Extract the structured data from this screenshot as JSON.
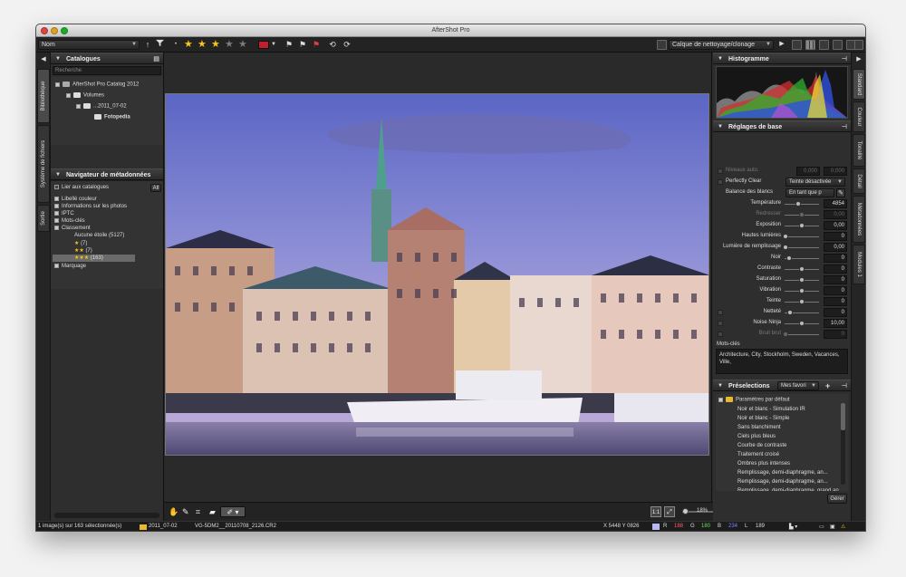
{
  "window": {
    "title": "AfterShot Pro"
  },
  "toolbar": {
    "sort_select": "Nom",
    "rating": 3,
    "rating_max": 5,
    "label_color": "#c0202a",
    "layer_select": "Calque de nettoyage/clonage"
  },
  "left_tabs": [
    "Bibliothèque",
    "Système de fichiers",
    "Sortie"
  ],
  "right_tabs": [
    "Standard",
    "Couleur",
    "Tonalité",
    "Détail",
    "Métadonnées",
    "Modules 1"
  ],
  "catalogs": {
    "title": "Catalogues",
    "search_placeholder": "Recherche",
    "items": [
      {
        "label": "AfterShot Pro Catalog 2012"
      },
      {
        "label": "Volumes"
      },
      {
        "label": "...2011_07-02"
      },
      {
        "label": "Fotopedia"
      }
    ]
  },
  "metadata_nav": {
    "title": "Navigateur de métadonnées",
    "link_label": "Lier aux catalogues",
    "all_label": "All",
    "items": [
      {
        "label": "Libellé couleur"
      },
      {
        "label": "Informations sur les photos"
      },
      {
        "label": "IPTC"
      },
      {
        "label": "Mots-clés"
      },
      {
        "label": "Classement"
      },
      {
        "label": "Aucune étoile (5127)"
      },
      {
        "label": "(7)"
      },
      {
        "label": "(7)"
      },
      {
        "label": "(163)"
      },
      {
        "label": "Marquage"
      }
    ]
  },
  "histogram": {
    "title": "Histogramme"
  },
  "basic": {
    "title": "Réglages de base",
    "niveaux": {
      "label": "Niveaux auto.",
      "v1": "0,000",
      "v2": "0,000"
    },
    "perfectly_clear": {
      "label": "Perfectly Clear",
      "select": "Teinte désactivée"
    },
    "wb": {
      "label": "Balance des blancs",
      "select": "En tant que p"
    },
    "rows": [
      {
        "label": "Température",
        "value": "4854",
        "pos": 0.4,
        "dim": false
      },
      {
        "label": "Redresser",
        "value": "0,00",
        "pos": 0.5,
        "dim": true
      },
      {
        "label": "Exposition",
        "value": "0,00",
        "pos": 0.5,
        "dim": false
      },
      {
        "label": "Hautes lumières",
        "value": "0",
        "pos": 0.0,
        "dim": false
      },
      {
        "label": "Lumière de remplissage",
        "value": "0,00",
        "pos": 0.0,
        "dim": false
      },
      {
        "label": "Noir",
        "value": "0",
        "pos": 0.1,
        "dim": false
      },
      {
        "label": "Contraste",
        "value": "0",
        "pos": 0.5,
        "dim": false
      },
      {
        "label": "Saturation",
        "value": "0",
        "pos": 0.5,
        "dim": false
      },
      {
        "label": "Vibration",
        "value": "0",
        "pos": 0.5,
        "dim": false
      },
      {
        "label": "Teinte",
        "value": "0",
        "pos": 0.5,
        "dim": false
      },
      {
        "label": "Netteté",
        "value": "0",
        "pos": 0.15,
        "dim": false
      },
      {
        "label": "Noise Ninja",
        "value": "10,00",
        "pos": 0.5,
        "dim": false
      },
      {
        "label": "Bruit brut",
        "value": "0",
        "pos": 0.0,
        "dim": true
      }
    ]
  },
  "keywords": {
    "label": "Mots-clés",
    "value": "Architecture, City, Stockholm, Sweden, Vacances, Ville,"
  },
  "presets": {
    "title": "Préselections",
    "select": "Mes favori",
    "folder": "Paramètres par défaut",
    "items": [
      "Noir et blanc - Simulation IR",
      "Noir et blanc - Simple",
      "Sans blanchiment",
      "Ciels plus bleus",
      "Courbe de contraste",
      "Traitement croisé",
      "Ombres plus intenses",
      "Remplissage, demi-diaphragme, an...",
      "Remplissage, demi-diaphragme, an...",
      "Remplissage, demi-diaphragme, grand an..."
    ],
    "manage": "Gérer"
  },
  "viewer": {
    "zoom": "18%",
    "zoom_level": 0.18
  },
  "status": {
    "selection": "1 image(s) sur 163 sélectionnée(s)",
    "folder": "2011_07-02",
    "filename": "VG-5DM2__20110708_2126.CR2",
    "coords": "X 5448  Y 0826",
    "r_label": "R",
    "r": "188",
    "g_label": "G",
    "g": "180",
    "b_label": "B",
    "b": "234",
    "l_label": "L",
    "l": "189"
  }
}
